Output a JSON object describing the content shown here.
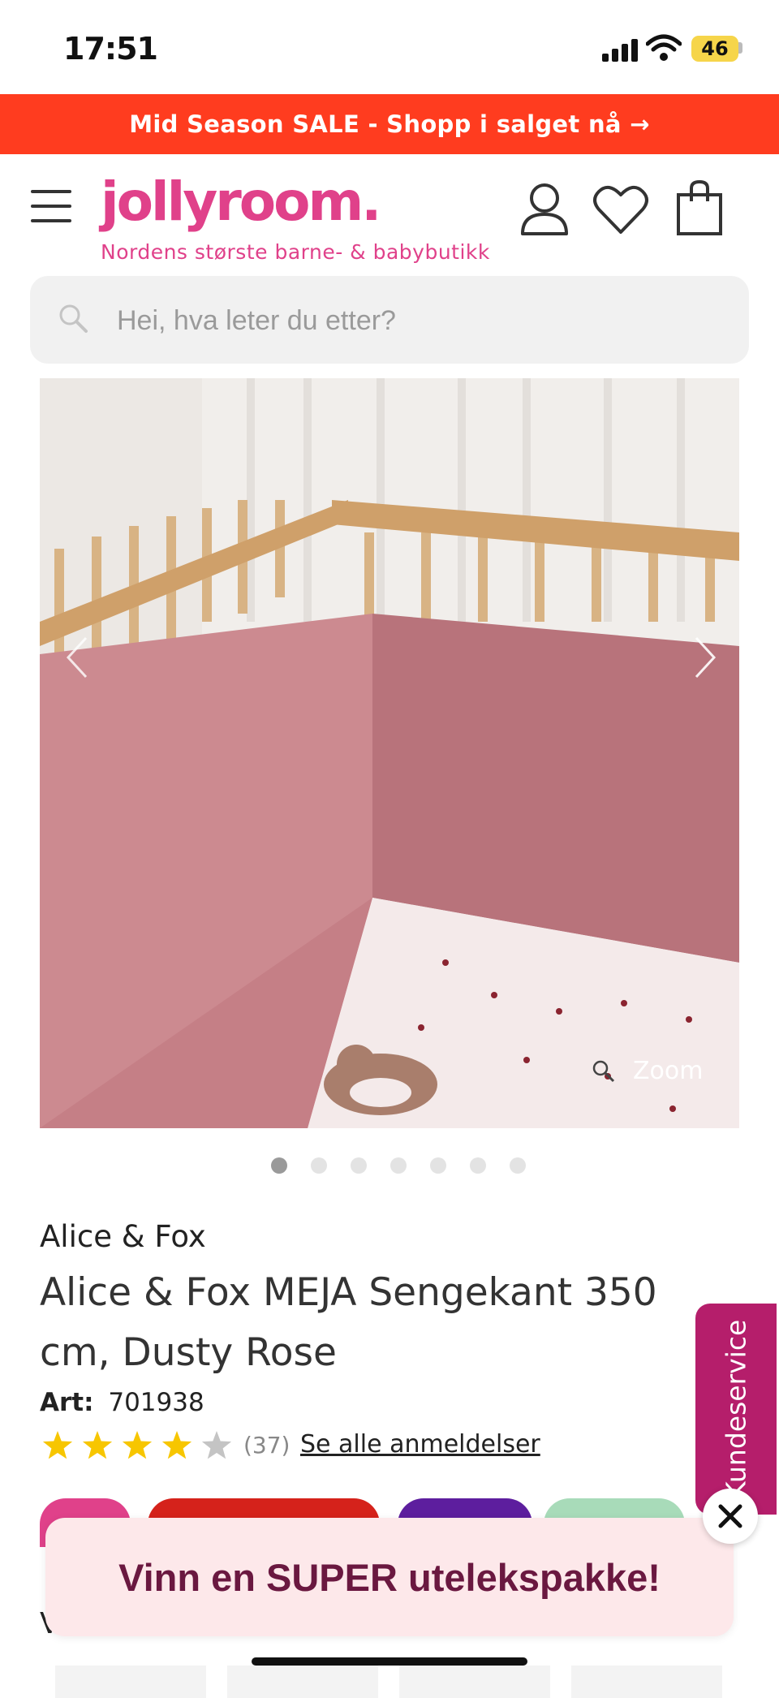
{
  "status_bar": {
    "time": "17:51",
    "battery": "46"
  },
  "promo": {
    "text": "Mid Season SALE - Shopp i salget nå →"
  },
  "header": {
    "logo": "jollyroom.",
    "tagline": "Nordens største barne- & babybutikk",
    "icons": [
      "menu-icon",
      "user-icon",
      "heart-icon",
      "bag-icon"
    ]
  },
  "search": {
    "placeholder": "Hei, hva leter du etter?"
  },
  "gallery": {
    "zoom_label": "Zoom",
    "image_count": 7,
    "active_index": 0
  },
  "product": {
    "brand": "Alice & Fox",
    "title": "Alice & Fox MEJA Sengekant 350 cm, Dusty Rose",
    "art_label": "Art:",
    "art_number": "701938",
    "rating": 4,
    "rating_max": 5,
    "review_count": "(37)",
    "review_link": "Se alle anmeldelser"
  },
  "customer_service": {
    "label": "Kundeservice"
  },
  "popup": {
    "text": "Vinn en SUPER utelekspakke!"
  },
  "colors": {
    "brand_pink": "#e0418a",
    "promo_red": "#ff3c1f",
    "star": "#f7c600",
    "cs_magenta": "#b51e6b",
    "popup_text": "#6a1840"
  }
}
